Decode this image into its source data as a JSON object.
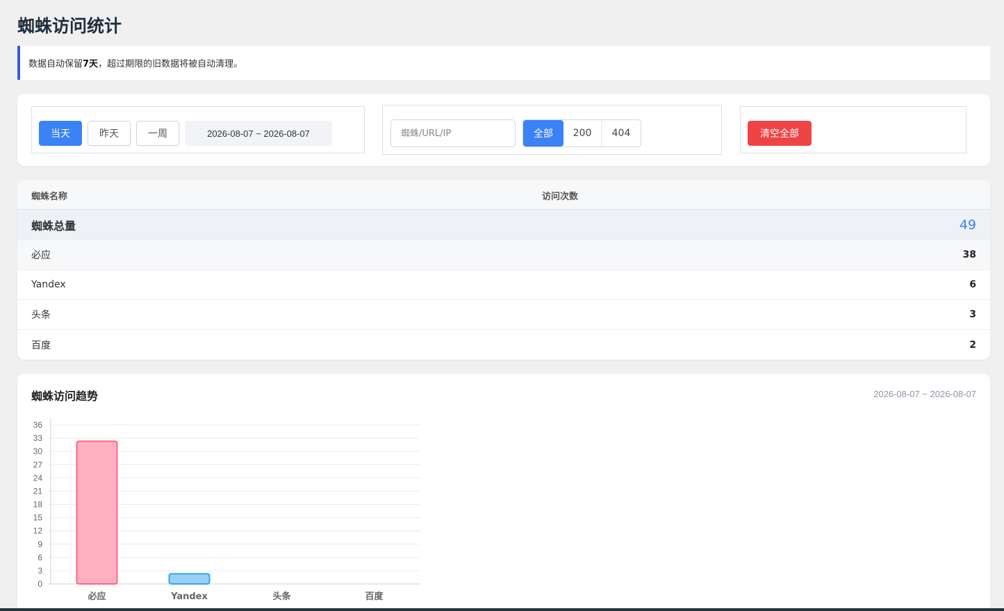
{
  "page": {
    "title": "蜘蛛访问统计"
  },
  "notice": {
    "prefix": "数据自动保留 ",
    "highlight": "7天",
    "suffix": "，超过期限的旧数据将被自动清理。"
  },
  "filters": {
    "range_buttons": [
      {
        "label": "当天",
        "active": true
      },
      {
        "label": "昨天",
        "active": false
      },
      {
        "label": "一周",
        "active": false
      }
    ],
    "date_range": "2026-08-07 ~ 2026-08-07",
    "search": {
      "placeholder": "蜘蛛/URL/IP",
      "value": ""
    },
    "status_tabs": [
      {
        "label": "全部",
        "active": true
      },
      {
        "label": "200",
        "active": false
      },
      {
        "label": "404",
        "active": false
      }
    ],
    "clear_all_label": "清空全部"
  },
  "table": {
    "headers": {
      "name": "蜘蛛名称",
      "count": "访问次数"
    },
    "total": {
      "label": "蜘蛛总量",
      "value": "49"
    },
    "rows": [
      {
        "name": "必应",
        "count": "38"
      },
      {
        "name": "Yandex",
        "count": "6"
      },
      {
        "name": "头条",
        "count": "3"
      },
      {
        "name": "百度",
        "count": "2"
      }
    ]
  },
  "chart_section": {
    "title": "蜘蛛访问趋势",
    "range": "2026-08-07 ~ 2026-08-07"
  },
  "chart_data": {
    "type": "bar",
    "categories": [
      "必应",
      "Yandex",
      "头条",
      "百度"
    ],
    "values": [
      32.3,
      2.3,
      0,
      0
    ],
    "ylim": [
      0,
      36
    ],
    "yticks": [
      0,
      3,
      6,
      9,
      12,
      15,
      18,
      21,
      24,
      27,
      30,
      33,
      36
    ],
    "grid": true,
    "colors": {
      "必应": {
        "fill": "#ffb1c1",
        "stroke": "#ff6384"
      },
      "Yandex": {
        "fill": "#9ad0f5",
        "stroke": "#36a2eb"
      }
    }
  },
  "colors": {
    "primary": "#3b82f6",
    "danger": "#ef4444",
    "notice_border": "#3b5bdb"
  }
}
